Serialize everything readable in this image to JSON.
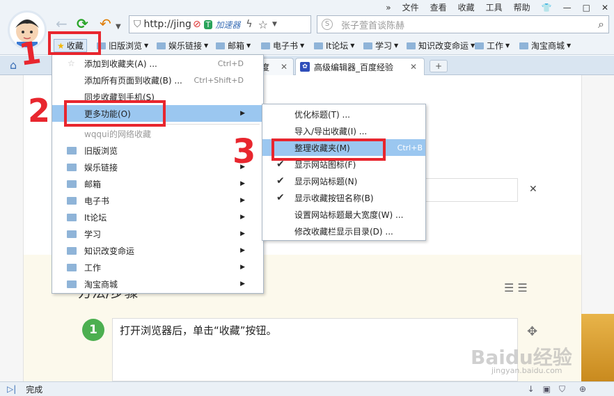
{
  "top_menu": [
    "»",
    "文件",
    "查看",
    "收藏",
    "工具",
    "帮助"
  ],
  "address": {
    "url": "http://jing",
    "accelerator": "加速器"
  },
  "search": {
    "placeholder": "张子萱首谈陈赫"
  },
  "favorites_bar": {
    "collect_label": "收藏",
    "items": [
      "旧版浏览",
      "娱乐链接",
      "邮箱",
      "电子书",
      "It论坛",
      "学习",
      "知识改变命运",
      "工作",
      "淘宝商城"
    ]
  },
  "tabs": {
    "partial_label": "度",
    "active_label": "高级编辑器_百度经验"
  },
  "menu1": {
    "items": [
      {
        "label": "添加到收藏夹(A) ...",
        "shortcut": "Ctrl+D"
      },
      {
        "label": "添加所有页面到收藏(B) ...",
        "shortcut": "Ctrl+Shift+D"
      },
      {
        "label": "同步收藏到手机(S)"
      },
      {
        "label": "更多功能(O)"
      }
    ],
    "account_label": "wqqui的网络收藏",
    "folders": [
      "旧版浏览",
      "娱乐链接",
      "邮箱",
      "电子书",
      "It论坛",
      "学习",
      "知识改变命运",
      "工作",
      "淘宝商城"
    ]
  },
  "menu2": {
    "items": [
      {
        "label": "优化标题(T) ..."
      },
      {
        "label": "导入/导出收藏(I) ..."
      },
      {
        "label": "整理收藏夹(M)",
        "shortcut": "Ctrl+B"
      },
      {
        "label": "显示网站图标(F)",
        "checked": true
      },
      {
        "label": "显示网站标题(N)",
        "checked": true
      },
      {
        "label": "显示收藏按钮名称(B)",
        "checked": true
      },
      {
        "label": "设置网站标题最大宽度(W) ..."
      },
      {
        "label": "修改收藏栏显示目录(D) ..."
      }
    ]
  },
  "page": {
    "heading_partial": "方法/步骤",
    "step_number": "1",
    "step_text": "打开浏览器后，单击“收藏”按钮。",
    "watermark": "Baidu经验",
    "watermark_url": "jingyan.baidu.com"
  },
  "annotations": [
    "1",
    "2",
    "3"
  ],
  "status": {
    "text": "完成"
  },
  "colors": {
    "highlight": "#9bc7f0",
    "annotation": "#e8262e",
    "step_badge": "#4caf50"
  }
}
